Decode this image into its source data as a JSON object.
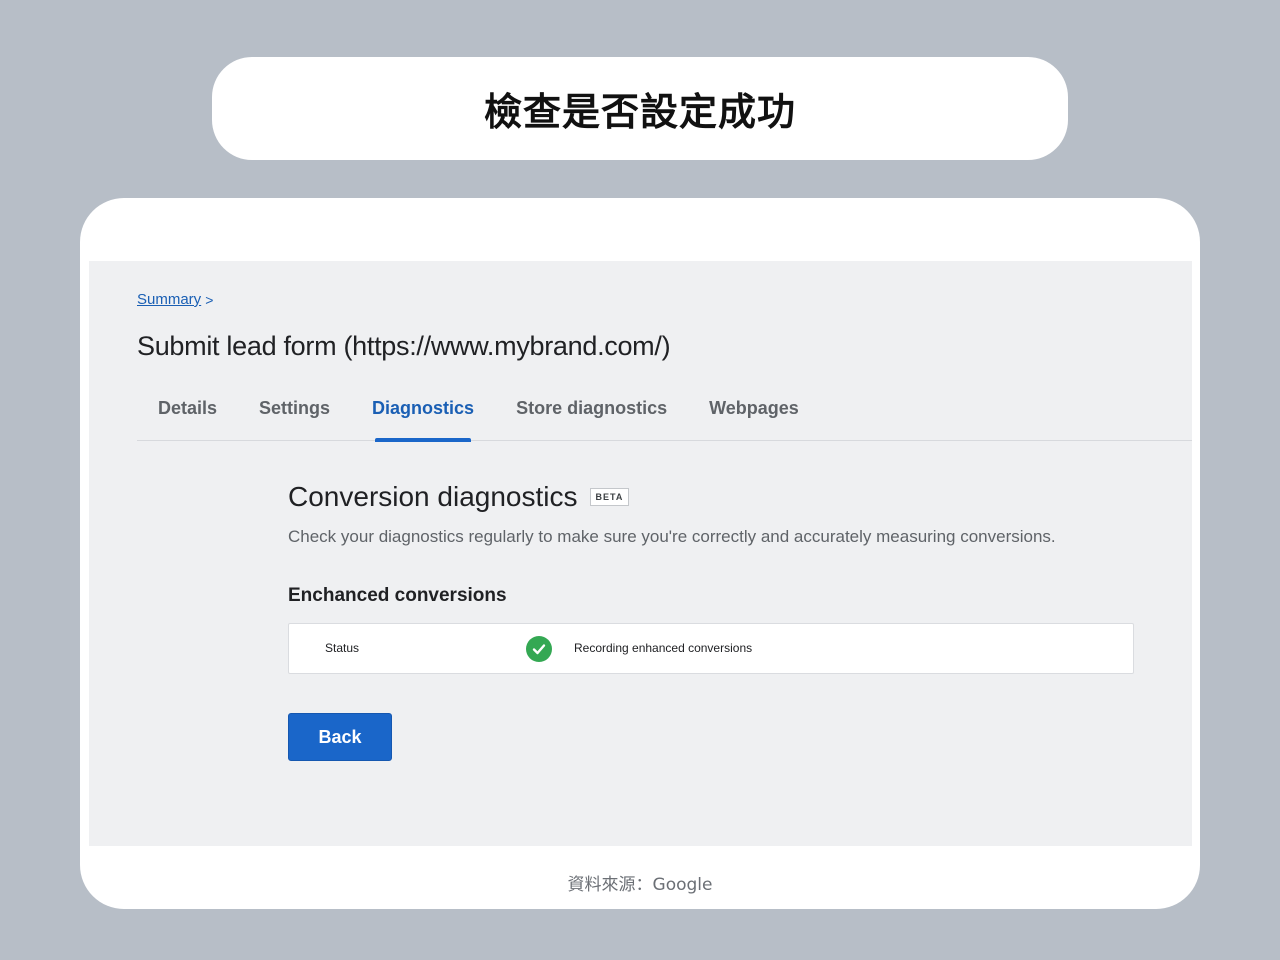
{
  "slide_title": "檢查是否設定成功",
  "breadcrumb": {
    "link": "Summary",
    "separator": ">"
  },
  "page_title": "Submit lead form (https://www.mybrand.com/)",
  "tabs": [
    {
      "label": "Details",
      "active": false
    },
    {
      "label": "Settings",
      "active": false
    },
    {
      "label": "Diagnostics",
      "active": true
    },
    {
      "label": "Store diagnostics",
      "active": false
    },
    {
      "label": "Webpages",
      "active": false
    }
  ],
  "diagnostics": {
    "heading": "Conversion diagnostics",
    "badge": "BETA",
    "description": "Check your diagnostics regularly to make sure you're correctly and accurately measuring conversions.",
    "subheading": "Enchanced conversions",
    "status_label": "Status",
    "status_icon": "check-circle-icon",
    "status_text": "Recording enhanced conversions"
  },
  "back_button": "Back",
  "source": "資料來源：Google",
  "colors": {
    "background": "#b7bec7",
    "accent": "#1a66c9",
    "success": "#34a853"
  }
}
